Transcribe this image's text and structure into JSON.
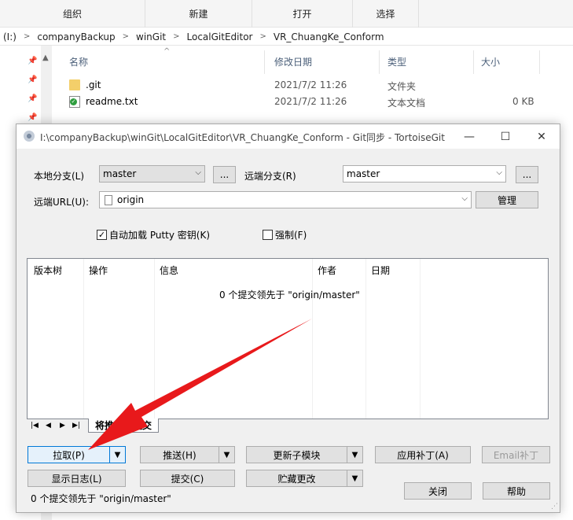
{
  "ribbon": {
    "groups": [
      "组织",
      "新建",
      "打开",
      "选择"
    ]
  },
  "address": {
    "drive": "(I:)",
    "segments": [
      "companyBackup",
      "winGit",
      "LocalGitEditor",
      "VR_ChuangKe_Conform"
    ]
  },
  "columns": {
    "name": "名称",
    "modified": "修改日期",
    "type": "类型",
    "size": "大小"
  },
  "files": [
    {
      "name": ".git",
      "modified": "2021/7/2 11:26",
      "type": "文件夹",
      "size": ""
    },
    {
      "name": "readme.txt",
      "modified": "2021/7/2 11:26",
      "type": "文本文档",
      "size": "0 KB"
    }
  ],
  "dialog": {
    "title": "I:\\companyBackup\\winGit\\LocalGitEditor\\VR_ChuangKe_Conform - Git同步 - TortoiseGit",
    "local_branch_label": "本地分支(L)",
    "local_branch_value": "master",
    "remote_branch_label": "远端分支(R)",
    "remote_branch_value": "master",
    "ellipsis": "...",
    "remote_url_label": "远端URL(U):",
    "remote_url_value": "origin",
    "manage_label": "管理",
    "autoload_putty_label": "自动加载 Putty 密钥(K)",
    "autoload_putty_checked": true,
    "force_label": "强制(F)",
    "force_checked": false,
    "list_headers": [
      "版本树",
      "操作",
      "信息",
      "作者",
      "日期"
    ],
    "list_message": "0 个提交领先于 \"origin/master\"",
    "tab_label": "将推送的提交",
    "buttons": {
      "pull": "拉取(P)",
      "push": "推送(H)",
      "update_submodules": "更新子模块",
      "apply_patch": "应用补丁(A)",
      "email_patch": "Email补丁",
      "show_log": "显示日志(L)",
      "commit": "提交(C)",
      "stash": "贮藏更改",
      "close": "关闭",
      "help": "帮助"
    },
    "status": "0 个提交领先于 \"origin/master\""
  },
  "colors": {
    "accent": "#0078d7",
    "arrow": "#e8191b"
  }
}
